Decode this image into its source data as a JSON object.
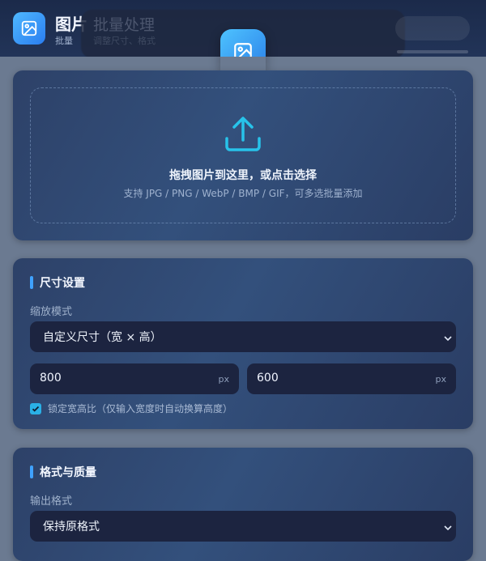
{
  "header": {
    "title": "图片",
    "subtitle": "批量",
    "overlay_title": "批量处理",
    "overlay_subtitle": "调整尺寸、格式"
  },
  "upload": {
    "title": "拖拽图片到这里，或点击选择",
    "hint": "支持 JPG / PNG / WebP / BMP / GIF，可多选批量添加",
    "icon": "upload-icon"
  },
  "size_settings": {
    "section_title": "尺寸设置",
    "mode_label": "缩放模式",
    "mode_value": "自定义尺寸（宽 × 高）",
    "width_value": "800",
    "height_value": "600",
    "unit": "px",
    "lock_ratio_label": "锁定宽高比（仅输入宽度时自动换算高度）",
    "lock_ratio_checked": true
  },
  "format_quality": {
    "section_title": "格式与质量",
    "format_label": "输出格式",
    "format_value": "保持原格式"
  },
  "colors": {
    "accent": "#3fa2ff",
    "checkbox": "#2ab0e6",
    "input_bg": "#1c2440"
  }
}
